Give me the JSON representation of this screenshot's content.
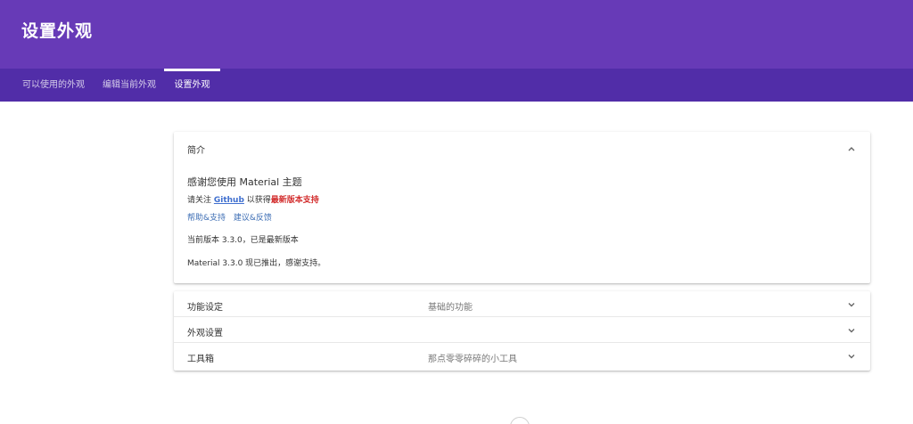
{
  "header": {
    "title": "设置外观"
  },
  "tabs": [
    {
      "label": "可以使用的外观"
    },
    {
      "label": "编辑当前外观"
    },
    {
      "label": "设置外观"
    }
  ],
  "intro": {
    "heading": "简介",
    "thanks": "感谢您使用 Material 主题",
    "follow_prefix": "请关注 ",
    "github_label": "Github",
    "follow_mid": " 以获得",
    "follow_strong": "最新版本支持",
    "help_link": "帮助&支持",
    "feedback_link": "建议&反馈",
    "version_text": "当前版本 3.3.0，已是最新版本",
    "release_text": "Material 3.3.0 现已推出，感谢支持。"
  },
  "sections": [
    {
      "label": "功能设定",
      "desc": "基础的功能"
    },
    {
      "label": "外观设置",
      "desc": ""
    },
    {
      "label": "工具箱",
      "desc": "那点零零碎碎的小工具"
    }
  ],
  "icons": {
    "collapse": "chevron-up-icon",
    "expand": "chevron-down-icon"
  },
  "colors": {
    "primary": "#673ab7",
    "primary_dark": "#512da8",
    "accent_red": "#d32f2f",
    "link": "#3f6fcf"
  }
}
